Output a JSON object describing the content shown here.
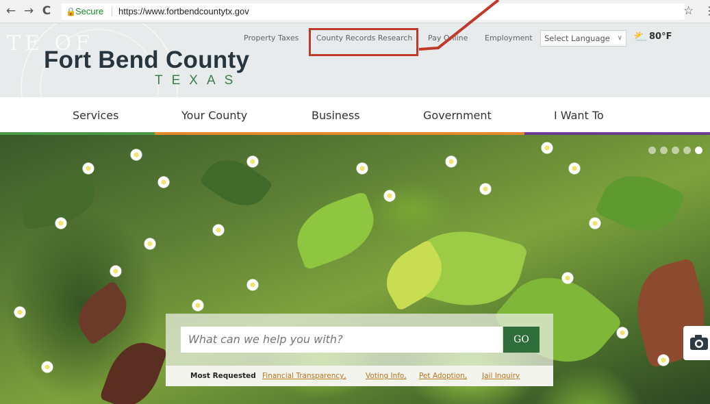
{
  "browser": {
    "back_icon": "←",
    "forward_icon": "→",
    "reload_icon": "C",
    "secure_label": "Secure",
    "url": "https://www.fortbendcountytx.gov",
    "bookmark_icon": "☆",
    "menu_icon": "⋮"
  },
  "header": {
    "title": "Fort Bend County",
    "subtitle": "TEXAS",
    "seal_text": "TE OF",
    "utility_links": [
      "Property Taxes",
      "County Records Research",
      "Pay Online",
      "Employment"
    ],
    "language_select": "Select Language",
    "language_caret": "∨",
    "weather_icon": "⛅",
    "weather_temp": "80°F"
  },
  "nav": {
    "items": [
      "Services",
      "Your County",
      "Business",
      "Government",
      "I Want To"
    ],
    "bar_colors": [
      "#4a9a48",
      "#e38b2a",
      "#e38b2a",
      "#e38b2a",
      "#6a3d8f"
    ]
  },
  "hero": {
    "slide_count": 5,
    "active_slide": 5
  },
  "search": {
    "placeholder": "What can we help you with?",
    "go_label": "GO",
    "most_requested_label": "Most Requested",
    "links": [
      "Financial Transparency,",
      "Voting Info,",
      "Pet Adoption,",
      "Jail Inquiry"
    ]
  },
  "annotation": {
    "color": "#c0392b"
  }
}
